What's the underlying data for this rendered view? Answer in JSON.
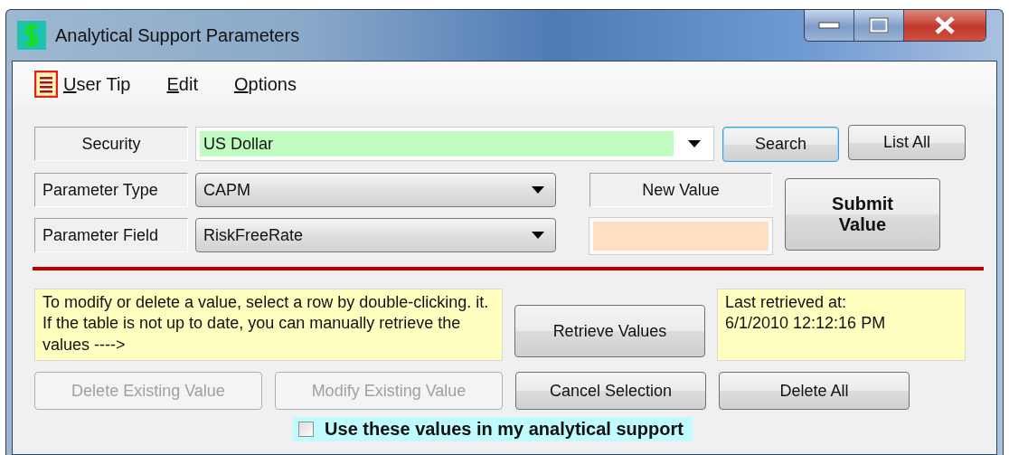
{
  "window": {
    "title": "Analytical Support Parameters"
  },
  "menu": [
    {
      "label": "User Tip",
      "underline_first": true,
      "kind": "tip"
    },
    {
      "label": "Edit",
      "underline_first": true,
      "kind": "plain"
    },
    {
      "label": "Options",
      "underline_first": true,
      "kind": "plain"
    }
  ],
  "security": {
    "label": "Security",
    "value": "US Dollar"
  },
  "search_buttons": [
    {
      "label": "Search",
      "focused": true
    },
    {
      "label": "List All",
      "focused": false
    }
  ],
  "parameter_type": {
    "label": "Parameter Type",
    "value": "CAPM"
  },
  "parameter_field": {
    "label": "Parameter Field",
    "value": "RiskFreeRate"
  },
  "new_value": {
    "label": "New Value"
  },
  "submit_button": {
    "label": "Submit Value"
  },
  "note": "To modify or delete a value, select a row by double-clicking. it.  If the table is not up to date, you can manually retrieve the values ---->",
  "retrieve_button": {
    "label": "Retrieve Values"
  },
  "last_retrieved": {
    "label": "Last retrieved at:",
    "value": "6/1/2010 12:12:16 PM"
  },
  "actions": [
    {
      "label": "Delete Existing Value",
      "disabled": true
    },
    {
      "label": "Modify Existing Value",
      "disabled": true
    },
    {
      "label": "Cancel Selection",
      "disabled": false
    },
    {
      "label": "Delete All",
      "disabled": false
    }
  ],
  "use_values": {
    "label": "Use these values in my analytical support",
    "checked": false
  }
}
